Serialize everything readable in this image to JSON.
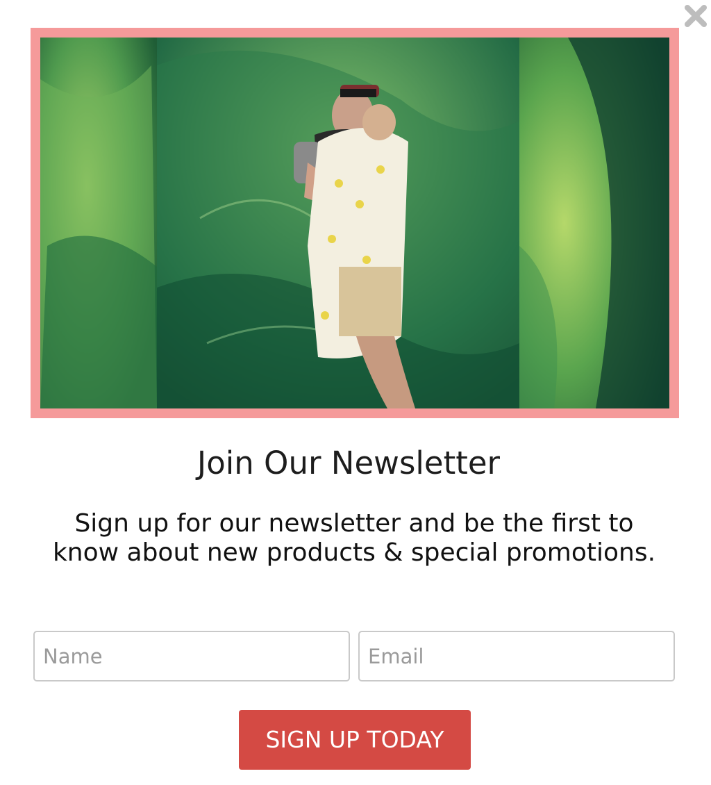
{
  "popup": {
    "close_icon": "close-icon",
    "title": "Join Our Newsletter",
    "subtitle": "Sign up for our newsletter and be the first to know about new products & special promotions.",
    "name_placeholder": "Name",
    "email_placeholder": "Email",
    "submit_label": "SIGN UP TODAY",
    "colors": {
      "frame": "#f59a9a",
      "button": "#d44a44",
      "close": "#bdbdbd"
    }
  }
}
